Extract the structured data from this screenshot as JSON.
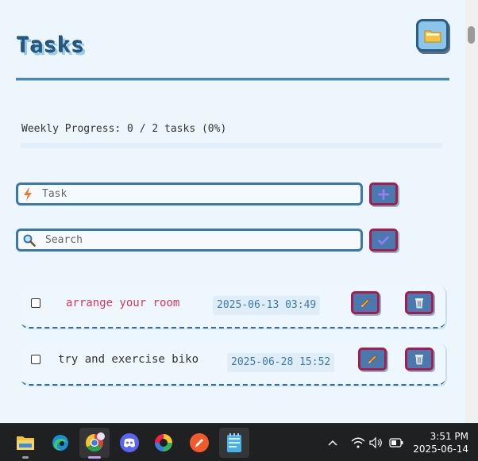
{
  "app": {
    "title": "Tasks",
    "progress_label": "Weekly Progress: 0 / 2 tasks (0%)",
    "progress_fraction": 0,
    "task_input": {
      "placeholder": "Task",
      "value": ""
    },
    "search_input": {
      "placeholder": "Search",
      "value": ""
    },
    "tasks": [
      {
        "text": "arrange your room",
        "datetime": "2025-06-13 03:49",
        "checked": false,
        "overdue": true
      },
      {
        "text": "try and exercise biko",
        "datetime": "2025-06-28 15:52",
        "checked": false,
        "overdue": false
      }
    ],
    "colors": {
      "background": "#edf6fd",
      "accent": "#3c78a6",
      "button": "#4a79b0",
      "button_border": "#a51d4c",
      "overdue_text": "#d7365f"
    }
  },
  "taskbar": {
    "apps": [
      "file-explorer-icon",
      "edge-icon",
      "chrome-icon",
      "discord-icon",
      "color-wheel-icon",
      "pen-app-icon",
      "notepad-icon"
    ],
    "clock": {
      "time": "3:51 PM",
      "date": "2025-06-14"
    }
  }
}
